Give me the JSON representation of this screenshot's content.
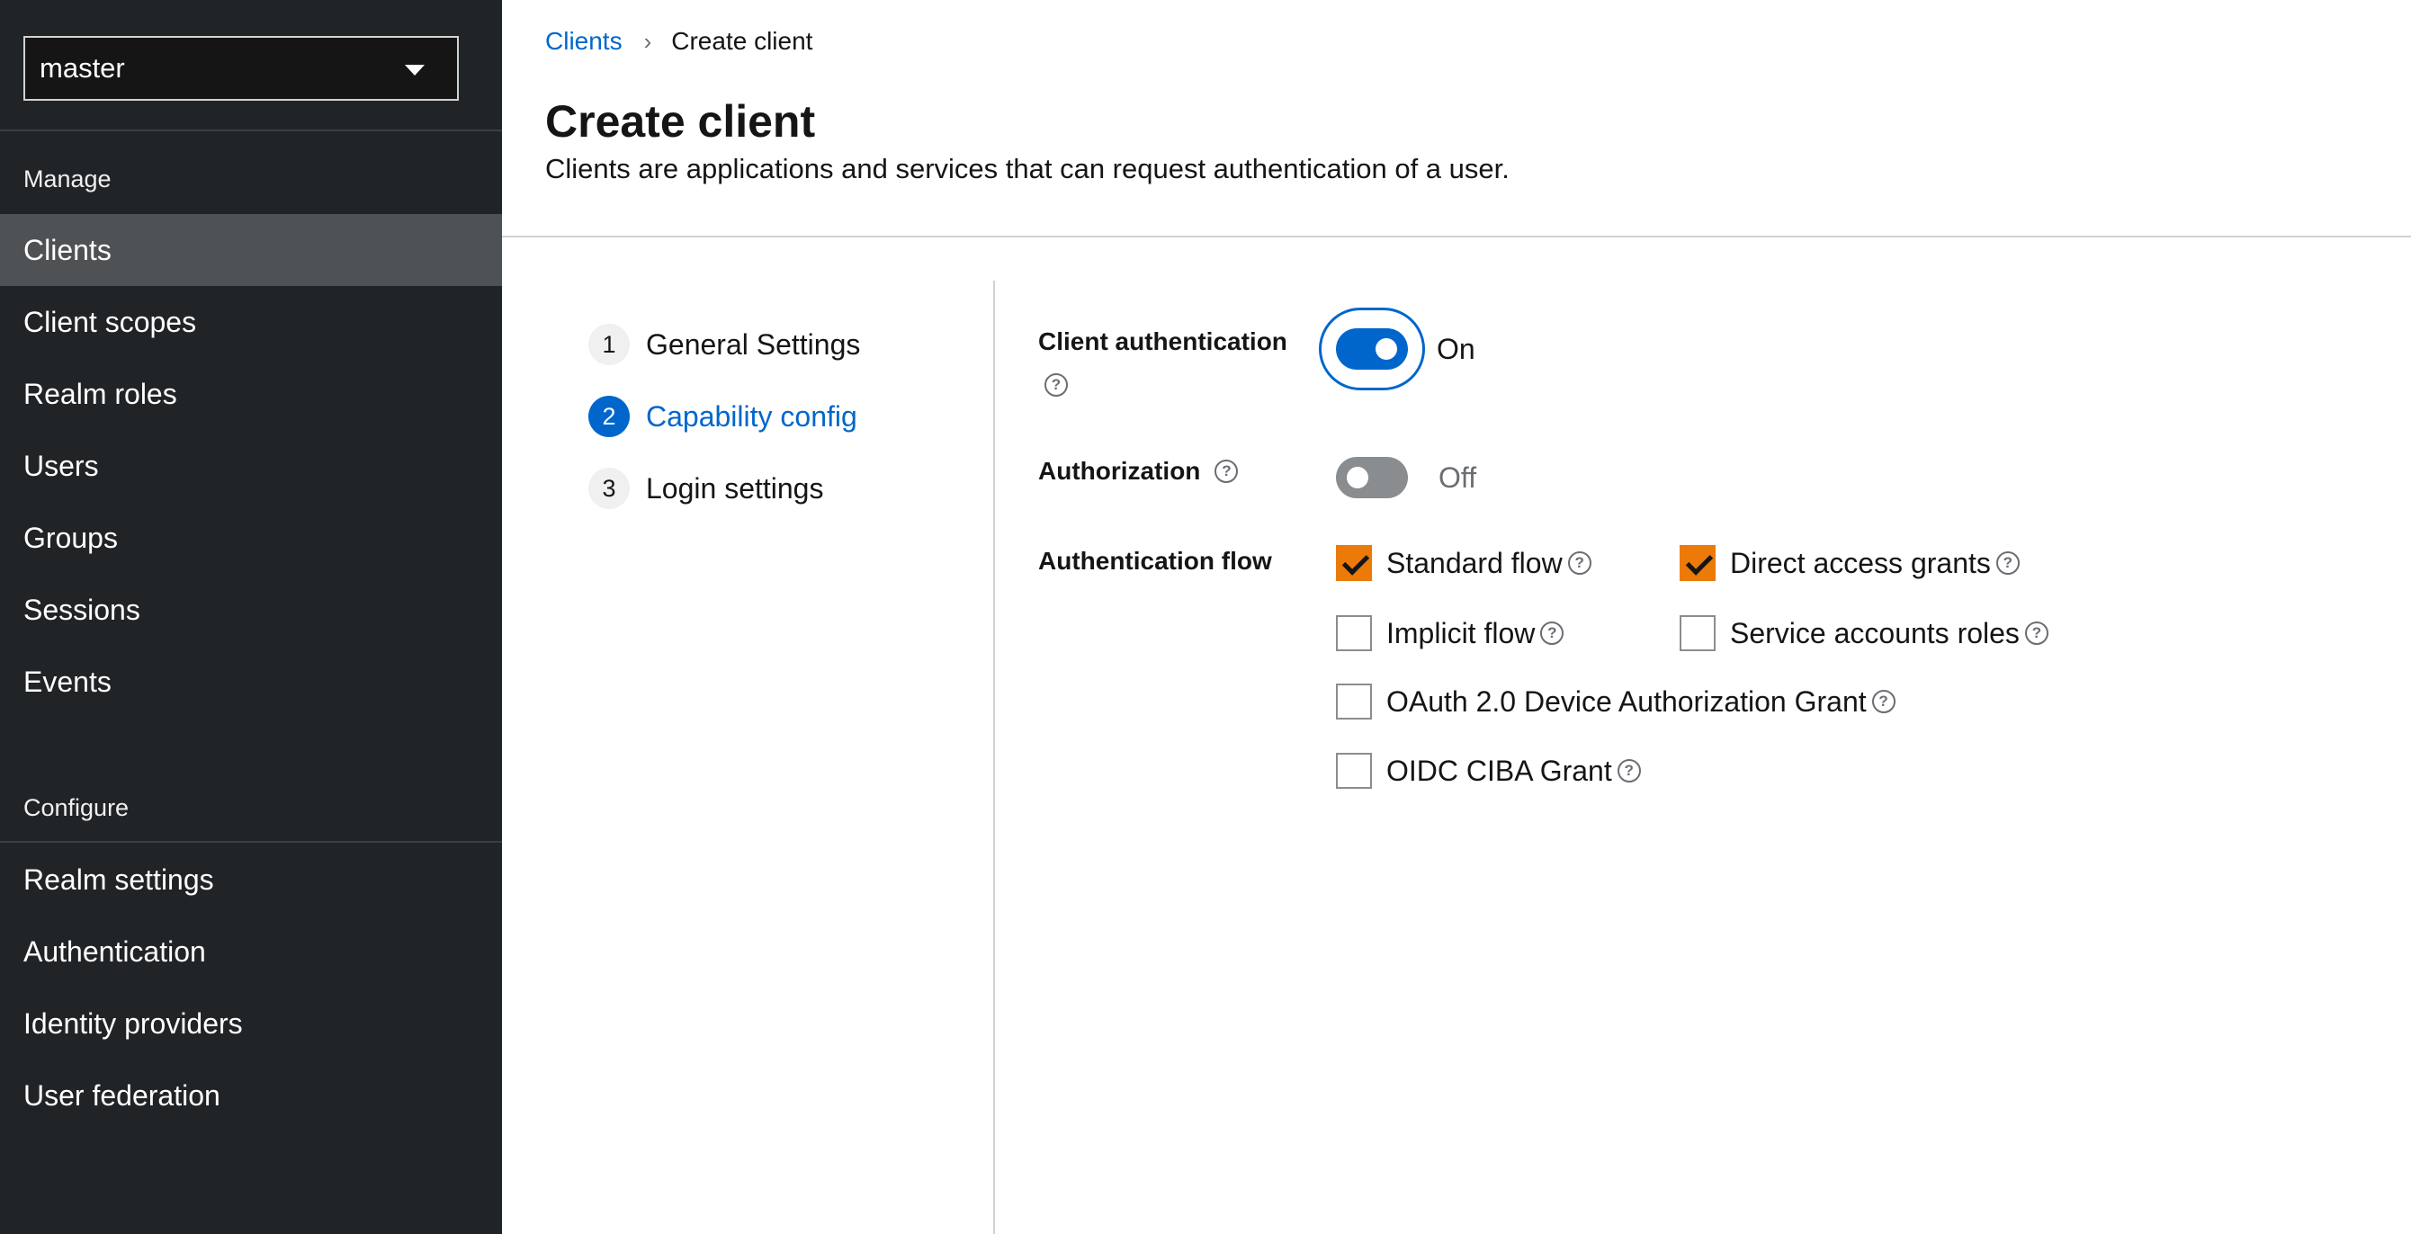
{
  "sidebar": {
    "realm": "master",
    "sections": {
      "manage": "Manage",
      "configure": "Configure"
    },
    "manage_items": [
      {
        "label": "Clients",
        "active": true
      },
      {
        "label": "Client scopes"
      },
      {
        "label": "Realm roles"
      },
      {
        "label": "Users"
      },
      {
        "label": "Groups"
      },
      {
        "label": "Sessions"
      },
      {
        "label": "Events"
      }
    ],
    "configure_items": [
      {
        "label": "Realm settings"
      },
      {
        "label": "Authentication"
      },
      {
        "label": "Identity providers"
      },
      {
        "label": "User federation"
      }
    ]
  },
  "breadcrumb": {
    "parent": "Clients",
    "separator": "›",
    "current": "Create client"
  },
  "header": {
    "title": "Create client",
    "description": "Clients are applications and services that can request authentication of a user."
  },
  "wizard": {
    "steps": [
      {
        "number": "1",
        "label": "General Settings"
      },
      {
        "number": "2",
        "label": "Capability config",
        "current": true
      },
      {
        "number": "3",
        "label": "Login settings"
      }
    ]
  },
  "form": {
    "help_glyph": "?",
    "client_auth": {
      "label": "Client authentication",
      "state": "On"
    },
    "authorization": {
      "label": "Authorization",
      "state": "Off"
    },
    "auth_flow": {
      "label": "Authentication flow",
      "options": {
        "standard": {
          "label": "Standard flow",
          "checked": true
        },
        "direct": {
          "label": "Direct access grants",
          "checked": true
        },
        "implicit": {
          "label": "Implicit flow",
          "checked": false
        },
        "service": {
          "label": "Service accounts roles",
          "checked": false
        },
        "device": {
          "label": "OAuth 2.0 Device Authorization Grant",
          "checked": false
        },
        "ciba": {
          "label": "OIDC CIBA Grant",
          "checked": false
        }
      }
    }
  },
  "colors": {
    "sidebar_bg": "#212427",
    "active_item": "#4f5255",
    "link_blue": "#0066cc",
    "checkbox_orange": "#ec7a08"
  }
}
